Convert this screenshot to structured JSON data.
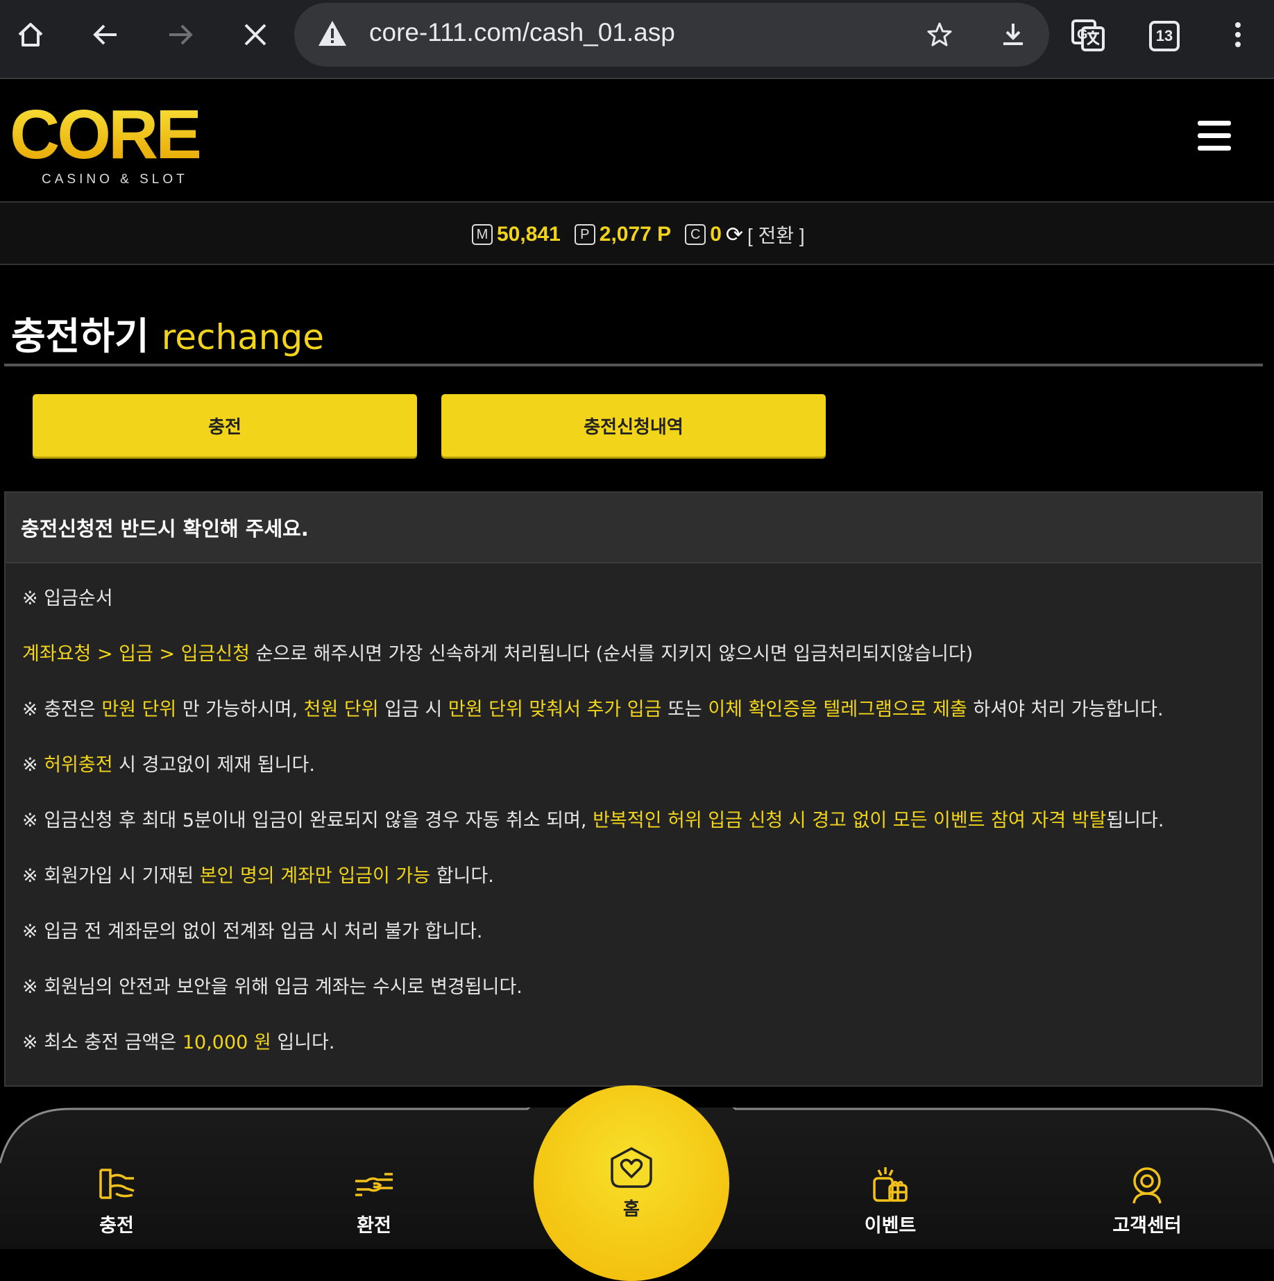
{
  "browser": {
    "url": "core-111.com/cash_01.asp",
    "tab_count": "13"
  },
  "site": {
    "logo_text": "CORE",
    "logo_subtitle": "CASINO & SLOT"
  },
  "balance": {
    "money_icon": "M",
    "money": "50,841",
    "point_icon": "P",
    "points": "2,077 P",
    "coin_icon": "C",
    "coins": "0",
    "switch_label": "[ 전환 ]"
  },
  "page": {
    "title_ko": "충전하기",
    "title_en": "rechange"
  },
  "tabs": [
    {
      "label": "충전"
    },
    {
      "label": "충전신청내역"
    }
  ],
  "notice": {
    "header": "충전신청전 반드시 확인해 주세요.",
    "lines": [
      [
        {
          "t": "※ 입금순서",
          "h": false
        }
      ],
      [
        {
          "t": "계좌요청 > 입금 > 입금신청",
          "h": true
        },
        {
          "t": " 순으로 해주시면 가장 신속하게 처리됩니다 (순서를 지키지 않으시면 입금처리되지않습니다)",
          "h": false
        }
      ],
      [
        {
          "t": "※ 충전은 ",
          "h": false
        },
        {
          "t": "만원 단위",
          "h": true
        },
        {
          "t": " 만 가능하시며, ",
          "h": false
        },
        {
          "t": "천원 단위",
          "h": true
        },
        {
          "t": " 입금 시 ",
          "h": false
        },
        {
          "t": "만원 단위 맞춰서 추가 입금",
          "h": true
        },
        {
          "t": " 또는 ",
          "h": false
        },
        {
          "t": "이체 확인증을 텔레그램으로 제출",
          "h": true
        },
        {
          "t": " 하셔야 처리 가능합니다.",
          "h": false
        }
      ],
      [
        {
          "t": "※ ",
          "h": false
        },
        {
          "t": "허위충전",
          "h": true
        },
        {
          "t": " 시 경고없이 제재 됩니다.",
          "h": false
        }
      ],
      [
        {
          "t": "※ 입금신청 후 최대 5분이내 입금이 완료되지 않을 경우 자동 취소 되며, ",
          "h": false
        },
        {
          "t": "반복적인 허위 입금 신청 시 경고 없이 모든 이벤트 참여 자격 박탈",
          "h": true
        },
        {
          "t": "됩니다.",
          "h": false
        }
      ],
      [
        {
          "t": "※ 회원가입 시 기재된 ",
          "h": false
        },
        {
          "t": "본인 명의 계좌만 입금이 가능",
          "h": true
        },
        {
          "t": " 합니다.",
          "h": false
        }
      ],
      [
        {
          "t": "※ 입금 전 계좌문의 없이 전계좌 입금 시 처리 불가 합니다.",
          "h": false
        }
      ],
      [
        {
          "t": "※ 회원님의 안전과 보안을 위해 입금 계좌는 수시로 변경됩니다.",
          "h": false
        }
      ],
      [
        {
          "t": "※ 최소 충전 금액은 ",
          "h": false
        },
        {
          "t": "10,000 원",
          "h": true
        },
        {
          "t": " 입니다.",
          "h": false
        }
      ]
    ]
  },
  "bottom_nav": {
    "charge": "충전",
    "exchange": "환전",
    "home": "홈",
    "event": "이벤트",
    "support": "고객센터"
  },
  "colors": {
    "accent": "#f2d51a",
    "background": "#000000",
    "panel": "#232323"
  }
}
